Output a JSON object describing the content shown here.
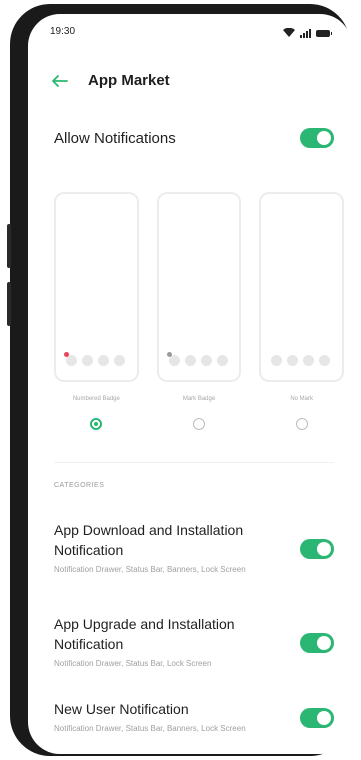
{
  "status_bar": {
    "time": "19:30"
  },
  "header": {
    "title": "App Market",
    "back_icon": "arrow-left-icon"
  },
  "allow_notifications": {
    "label": "Allow Notifications",
    "enabled": true
  },
  "badge_styles": [
    {
      "label": "Numbered Badge",
      "selected": true
    },
    {
      "label": "Mark Badge",
      "selected": false
    },
    {
      "label": "No Mark",
      "selected": false
    }
  ],
  "categories": {
    "header": "CATEGORIES",
    "items": [
      {
        "title": "App Download and Installation Notification",
        "subtitle": "Notification Drawer, Status Bar, Banners, Lock Screen",
        "enabled": true
      },
      {
        "title": "App Upgrade and Installation Notification",
        "subtitle": "Notification Drawer, Status Bar, Lock Screen",
        "enabled": true
      },
      {
        "title": "New User Notification",
        "subtitle": "Notification Drawer, Status Bar, Banners, Lock Screen",
        "enabled": true
      }
    ]
  },
  "colors": {
    "accent": "#2bb673",
    "badge": "#e8455c"
  }
}
